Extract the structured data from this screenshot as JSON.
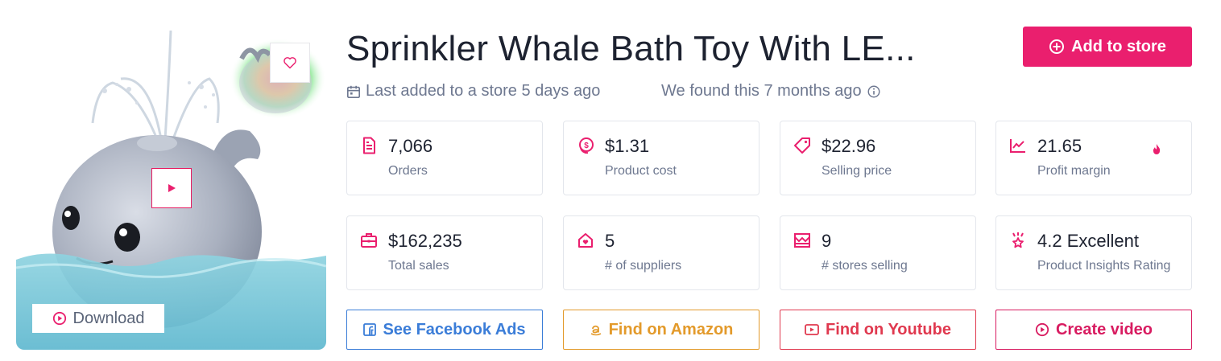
{
  "product": {
    "title": "Sprinkler Whale Bath Toy With LE...",
    "last_added": "Last added to a store 5 days ago",
    "found": "We found this 7 months ago"
  },
  "media": {
    "download_label": "Download"
  },
  "actions": {
    "add_to_store": "Add to store",
    "facebook": "See Facebook Ads",
    "amazon": "Find on Amazon",
    "youtube": "Find on Youtube",
    "create_video": "Create video"
  },
  "stats": [
    {
      "value": "7,066",
      "label": "Orders",
      "icon": "orders-icon"
    },
    {
      "value": "$1.31",
      "label": "Product cost",
      "icon": "cost-icon"
    },
    {
      "value": "$22.96",
      "label": "Selling price",
      "icon": "price-tag-icon"
    },
    {
      "value": "21.65",
      "label": "Profit margin",
      "icon": "chart-line-icon"
    },
    {
      "value": "$162,235",
      "label": "Total sales",
      "icon": "briefcase-icon"
    },
    {
      "value": "5",
      "label": "# of suppliers",
      "icon": "house-heart-icon"
    },
    {
      "value": "9",
      "label": "# stores selling",
      "icon": "store-icon"
    },
    {
      "value": "4.2 Excellent",
      "label": "Product Insights Rating",
      "icon": "award-icon"
    }
  ],
  "colors": {
    "accent": "#ea1f6e",
    "facebook": "#3b7dd8",
    "amazon": "#e39a2b",
    "youtube": "#e0394f",
    "video": "#d81b60"
  }
}
